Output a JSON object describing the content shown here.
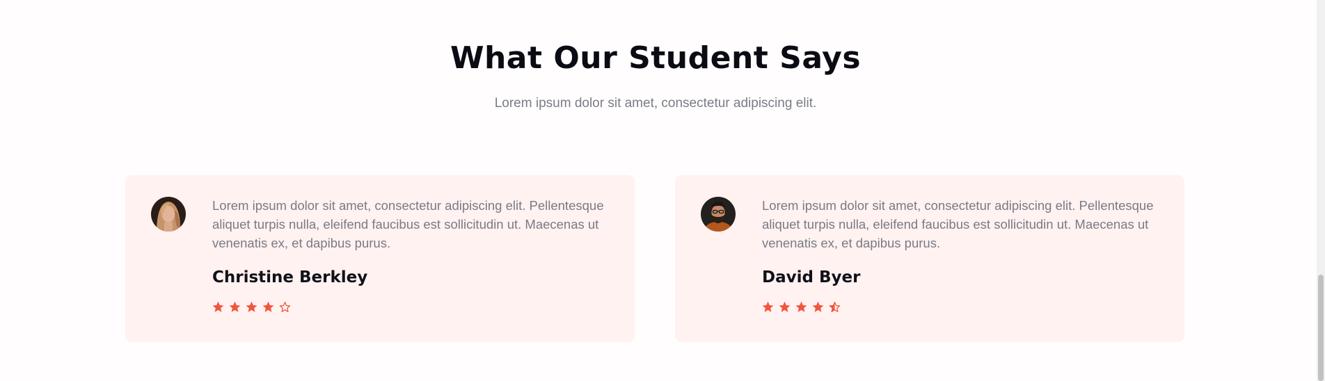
{
  "section": {
    "title": "What Our Student Says",
    "subtitle": "Lorem ipsum dolor sit amet, consectetur adipiscing elit."
  },
  "testimonials": [
    {
      "quote": "Lorem ipsum dolor sit amet, consectetur adipiscing elit. Pellentesque aliquet turpis nulla, eleifend faucibus est sollicitudin ut. Maecenas ut venenatis ex, et dapibus purus.",
      "name": "Christine Berkley",
      "rating": 4,
      "avatar": "woman-portrait"
    },
    {
      "quote": "Lorem ipsum dolor sit amet, consectetur adipiscing elit. Pellentesque aliquet turpis nulla, eleifend faucibus est sollicitudin ut. Maecenas ut venenatis ex, et dapibus purus.",
      "name": "David Byer",
      "rating": 4.5,
      "avatar": "man-portrait"
    }
  ],
  "colors": {
    "accent": "#f2553d",
    "card_bg": "#fff2f1",
    "heading": "#0b0b14",
    "body_text": "#7a7a85"
  },
  "icons": {
    "star_full": "star-filled-icon",
    "star_half": "star-half-icon",
    "star_empty": "star-outline-icon"
  }
}
